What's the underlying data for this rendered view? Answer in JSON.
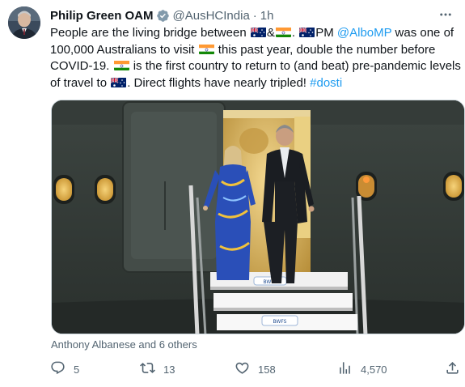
{
  "author": {
    "name": "Philip Green OAM",
    "handle": "@AusHCIndia",
    "separator": "·",
    "time": "1h"
  },
  "tweet": {
    "t1": "People are the living bridge between ",
    "t2": "&",
    "t3": ". ",
    "t4": "PM ",
    "mention": "@AlboMP",
    "t5": " was one of 100,000 Australians to visit ",
    "t6": " this past year, double the number before COVID-19. ",
    "t7": " is the first country to return to (and beat) pre-pandemic levels of travel to ",
    "t8": ". Direct flights have nearly tripled! ",
    "hashtag": "#dosti"
  },
  "media": {
    "alt": "Two people descending aircraft stairs at night",
    "stair_label_1": "BWFS",
    "stair_label_2": "BWFS"
  },
  "social_context": "Anthony Albanese and 6 others",
  "actions": {
    "replies": "5",
    "retweets": "13",
    "likes": "158",
    "views": "4,570"
  },
  "icons": {
    "verified": "verified-badge-icon",
    "more": "more-dots-icon",
    "reply": "reply-icon",
    "retweet": "retweet-icon",
    "like": "heart-icon",
    "views": "views-icon",
    "share": "share-icon"
  },
  "colors": {
    "link": "#1d9bf0",
    "secondary_text": "#536471",
    "verified_badge": "#829aab"
  }
}
